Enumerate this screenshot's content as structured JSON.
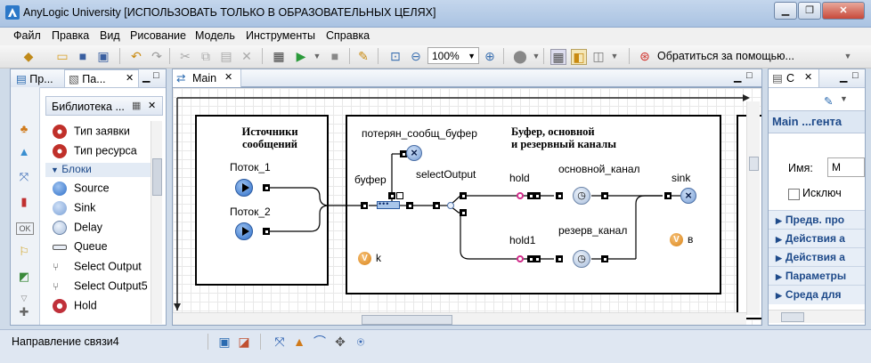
{
  "window": {
    "title": "AnyLogic University [ИСПОЛЬЗОВАТЬ ТОЛЬКО В ОБРАЗОВАТЕЛЬНЫХ ЦЕЛЯХ]",
    "controls": {
      "minimize": "▁",
      "maximize": "❐",
      "close": "✕"
    }
  },
  "menu": [
    "Файл",
    "Правка",
    "Вид",
    "Рисование",
    "Модель",
    "Инструменты",
    "Справка"
  ],
  "toolbar": {
    "zoom": "100%",
    "help_label": "Обратиться за помощью..."
  },
  "left_panel": {
    "tabs": [
      "Пр...",
      "Па..."
    ],
    "palette_title": "Библиотека ...",
    "items_top": [
      "Тип заявки",
      "Тип ресурса"
    ],
    "section": "Блоки",
    "blocks": [
      "Source",
      "Sink",
      "Delay",
      "Queue",
      "Select Output",
      "Select Output5",
      "Hold"
    ]
  },
  "editor": {
    "tab": "Main",
    "box_sources_title": "Источники\nсообщений",
    "box_buffer_title": "Буфер, основной\nи резервный каналы",
    "labels": {
      "source1": "Поток_1",
      "source2": "Поток_2",
      "lost": "потерян_сообщ_буфер",
      "buffer": "буфер",
      "select": "selectOutput",
      "hold": "hold",
      "hold1": "hold1",
      "main_channel": "основной_канал",
      "reserve_channel": "резерв_канал",
      "sink": "sink",
      "var_k": "k",
      "var_v": "в"
    }
  },
  "right_panel": {
    "tab": "С",
    "title": "Main ...гента",
    "name_label": "Имя:",
    "name_value": "M",
    "checkbox_label": "Исключ",
    "sections": [
      "Предв. про",
      "Действия а",
      "Действия а",
      "Параметры",
      "Среда для"
    ]
  },
  "status": {
    "text": "Направление связи4"
  }
}
